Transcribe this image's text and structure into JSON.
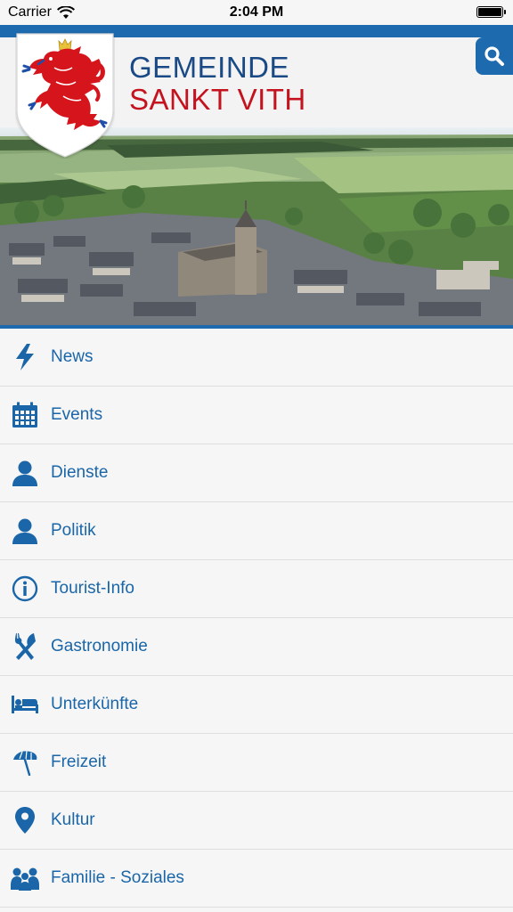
{
  "status_bar": {
    "carrier": "Carrier",
    "time": "2:04 PM"
  },
  "header": {
    "title_line1": "GEMEINDE",
    "title_line2": "SANKT VITH",
    "accent_color": "#1e6aae",
    "title_blue": "#1a4a86",
    "title_red": "#c4131e"
  },
  "menu": {
    "items": [
      {
        "label": "News",
        "icon": "lightning-icon"
      },
      {
        "label": "Events",
        "icon": "calendar-icon"
      },
      {
        "label": "Dienste",
        "icon": "person-icon"
      },
      {
        "label": "Politik",
        "icon": "person-icon"
      },
      {
        "label": "Tourist-Info",
        "icon": "info-icon"
      },
      {
        "label": "Gastronomie",
        "icon": "fork-knife-icon"
      },
      {
        "label": "Unterkünfte",
        "icon": "bed-icon"
      },
      {
        "label": "Freizeit",
        "icon": "umbrella-icon"
      },
      {
        "label": "Kultur",
        "icon": "map-pin-icon"
      },
      {
        "label": "Familie - Soziales",
        "icon": "family-icon"
      }
    ]
  }
}
